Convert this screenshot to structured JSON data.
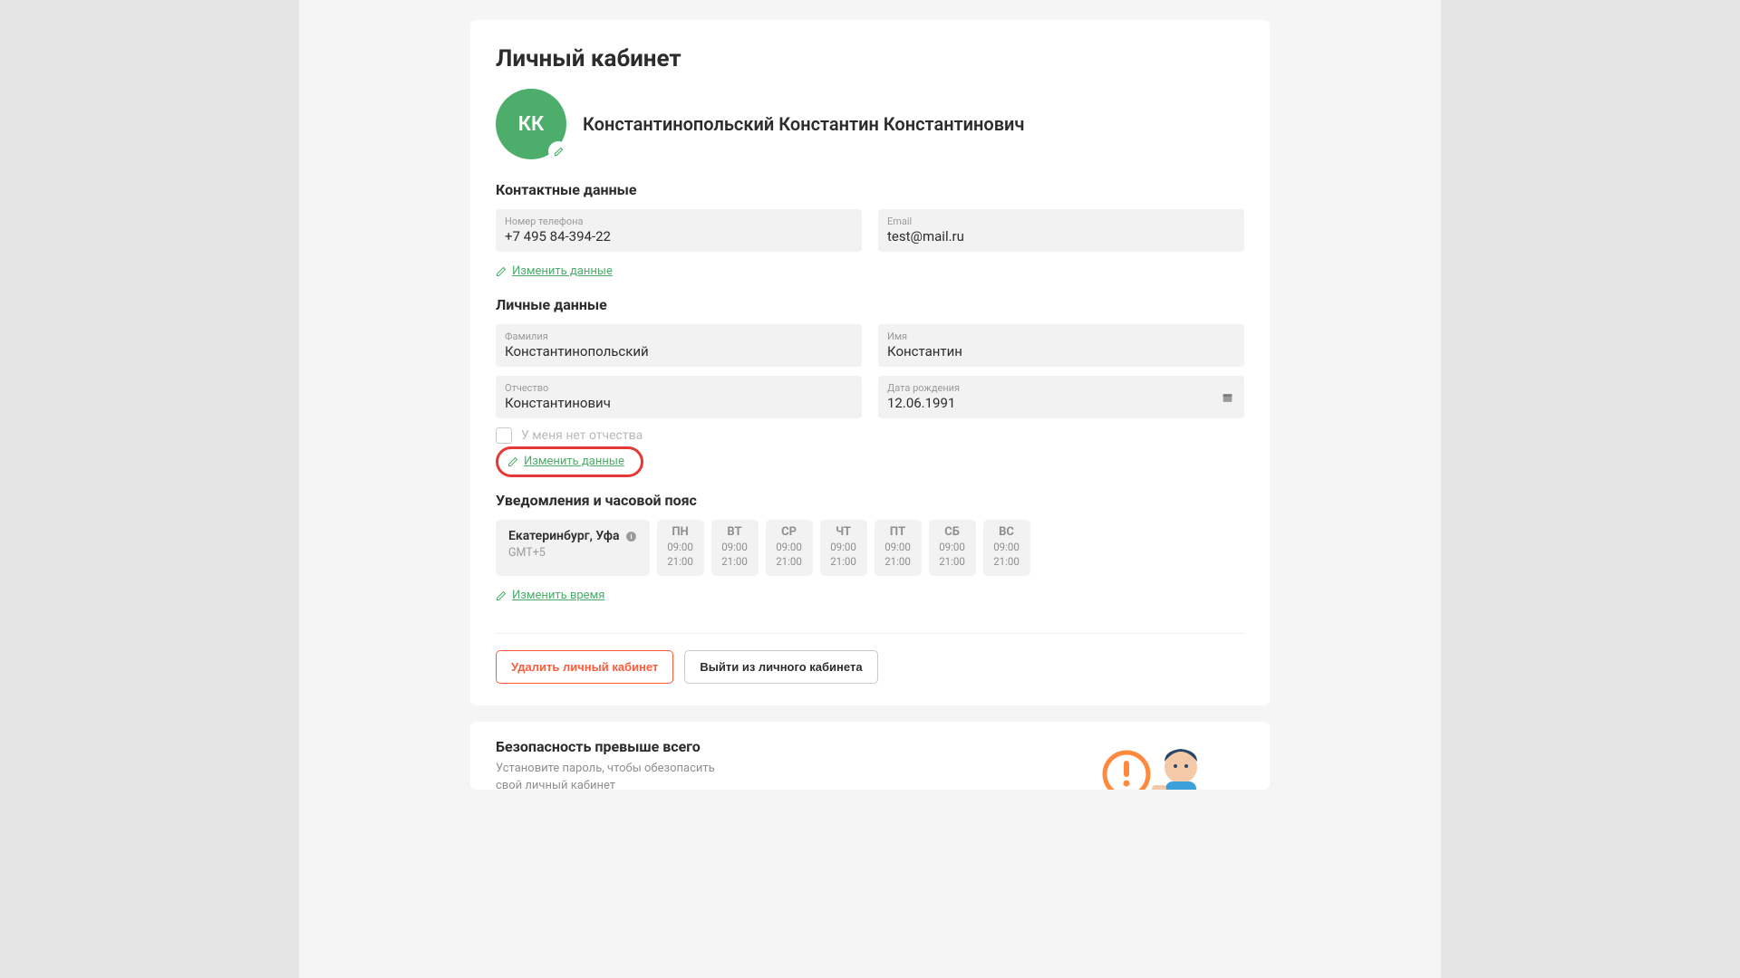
{
  "page": {
    "title": "Личный кабинет",
    "avatar_initials": "КК",
    "full_name": "Константинопольский Константин Константинович"
  },
  "contacts": {
    "heading": "Контактные данные",
    "phone_label": "Номер телефона",
    "phone_value": "+7 495 84-394-22",
    "email_label": "Email",
    "email_value": "test@mail.ru",
    "edit_link": "Изменить данные"
  },
  "personal": {
    "heading": "Личные данные",
    "surname_label": "Фамилия",
    "surname_value": "Константинопольский",
    "name_label": "Имя",
    "name_value": "Константин",
    "patronymic_label": "Отчество",
    "patronymic_value": "Константинович",
    "dob_label": "Дата рождения",
    "dob_value": "12.06.1991",
    "no_patronymic": "У меня нет отчества",
    "edit_link": "Изменить данные"
  },
  "notifications": {
    "heading": "Уведомления и часовой пояс",
    "timezone_city": "Екатеринбург, Уфа",
    "timezone_offset": "GMT+5",
    "days": [
      {
        "label": "ПН",
        "t1": "09:00",
        "t2": "21:00"
      },
      {
        "label": "ВТ",
        "t1": "09:00",
        "t2": "21:00"
      },
      {
        "label": "СР",
        "t1": "09:00",
        "t2": "21:00"
      },
      {
        "label": "ЧТ",
        "t1": "09:00",
        "t2": "21:00"
      },
      {
        "label": "ПТ",
        "t1": "09:00",
        "t2": "21:00"
      },
      {
        "label": "СБ",
        "t1": "09:00",
        "t2": "21:00"
      },
      {
        "label": "ВС",
        "t1": "09:00",
        "t2": "21:00"
      }
    ],
    "edit_link": "Изменить время"
  },
  "actions": {
    "delete": "Удалить личный кабинет",
    "logout": "Выйти из личного кабинета"
  },
  "security": {
    "heading": "Безопасность превыше всего",
    "text": "Установите пароль, чтобы обезопасить свой личный кабинет"
  }
}
